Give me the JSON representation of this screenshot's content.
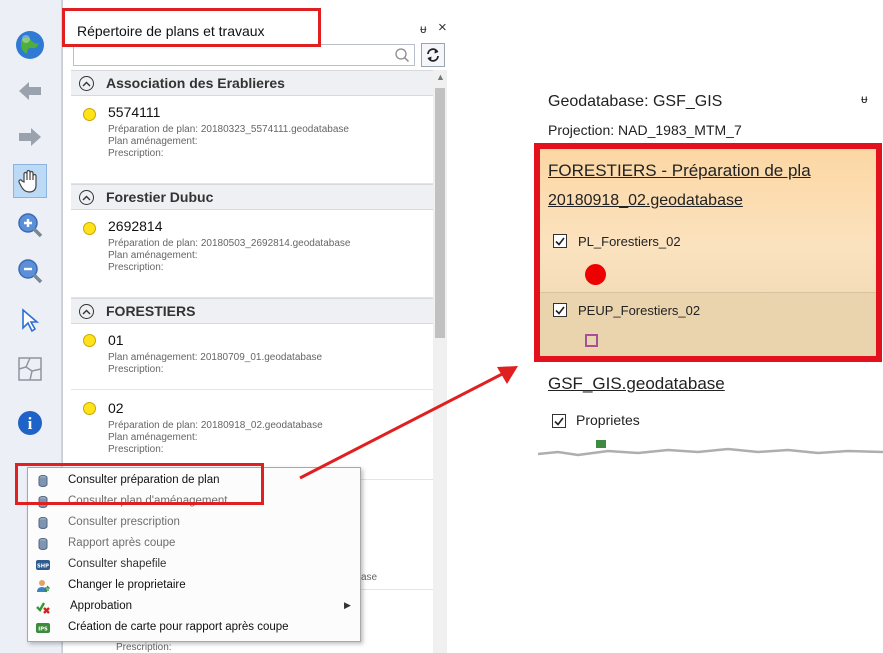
{
  "toolbar": {
    "tools": [
      {
        "name": "globe-icon"
      },
      {
        "name": "back-arrow-icon"
      },
      {
        "name": "forward-arrow-icon"
      },
      {
        "name": "pan-hand-icon"
      },
      {
        "name": "zoom-in-icon"
      },
      {
        "name": "zoom-out-icon"
      },
      {
        "name": "select-pointer-icon"
      },
      {
        "name": "full-extent-icon"
      },
      {
        "name": "info-icon"
      }
    ]
  },
  "panel": {
    "title": "Répertoire de plans et travaux",
    "pin_glyph": "ᵖ",
    "close_glyph": "×",
    "search": {
      "value": "",
      "placeholder": ""
    },
    "groups": [
      {
        "label": "Association des Erablieres",
        "items": [
          {
            "id": "5574111",
            "lines": [
              "Préparation de plan: 20180323_5574111.geodatabase",
              "Plan aménagement:",
              "Prescription:"
            ]
          }
        ]
      },
      {
        "label": "Forestier Dubuc",
        "items": [
          {
            "id": "2692814",
            "lines": [
              "Préparation de plan: 20180503_2692814.geodatabase",
              "Plan aménagement:",
              "Prescription:"
            ]
          }
        ]
      },
      {
        "label": "FORESTIERS",
        "items": [
          {
            "id": "01",
            "lines": [
              "Plan aménagement: 20180709_01.geodatabase",
              "Prescription:"
            ]
          },
          {
            "id": "02",
            "lines": [
              "Préparation de plan: 20180918_02.geodatabase",
              "Plan aménagement:",
              "Prescription:"
            ]
          }
        ]
      }
    ],
    "behind_menu": {
      "suffix": "ase",
      "last_line": "Prescription:"
    }
  },
  "context_menu": {
    "items": [
      {
        "label": "Consulter préparation de plan",
        "icon": "database-icon",
        "dim": false,
        "submenu": false
      },
      {
        "label": "Consulter plan d'aménagement",
        "icon": "database-icon",
        "dim": true,
        "submenu": false
      },
      {
        "label": "Consulter prescription",
        "icon": "database-icon",
        "dim": true,
        "submenu": false
      },
      {
        "label": "Rapport après coupe",
        "icon": "database-icon",
        "dim": true,
        "submenu": false
      },
      {
        "label": "Consulter shapefile",
        "icon": "shapefile-icon",
        "dim": true,
        "submenu": false
      },
      {
        "label": "Changer le proprietaire",
        "icon": "owner-icon",
        "dim": false,
        "submenu": false
      },
      {
        "label": "Approbation",
        "icon": "approval-icon",
        "dim": false,
        "submenu": true
      },
      {
        "label": "Création de carte pour rapport après coupe",
        "icon": "report-map-icon",
        "dim": false,
        "submenu": false
      }
    ],
    "shp_badge": "SHP",
    "ips_badge": "IPS"
  },
  "right_panel": {
    "title": "Geodatabase: GSF_GIS",
    "pin_glyph": "ᵖ",
    "projection": "Projection: NAD_1983_MTM_7",
    "highlighted_group_title_1": "FORESTIERS - Préparation de pla",
    "highlighted_group_title_2": "20180918_02.geodatabase",
    "layers": [
      {
        "name": "PL_Forestiers_02",
        "checked": true,
        "symbol": "red-circle"
      },
      {
        "name": "PEUP_Forestiers_02",
        "checked": true,
        "symbol": "purple-square"
      }
    ],
    "gdb_title": "GSF_GIS.geodatabase",
    "gdb_layer": "Proprietes"
  },
  "colors": {
    "highlight_red": "#e02020",
    "dot_yellow": "#ffe21a",
    "symbol_red": "#ee0000",
    "symbol_purple": "#a4519a",
    "layer_bg": "#fcd7a4"
  }
}
